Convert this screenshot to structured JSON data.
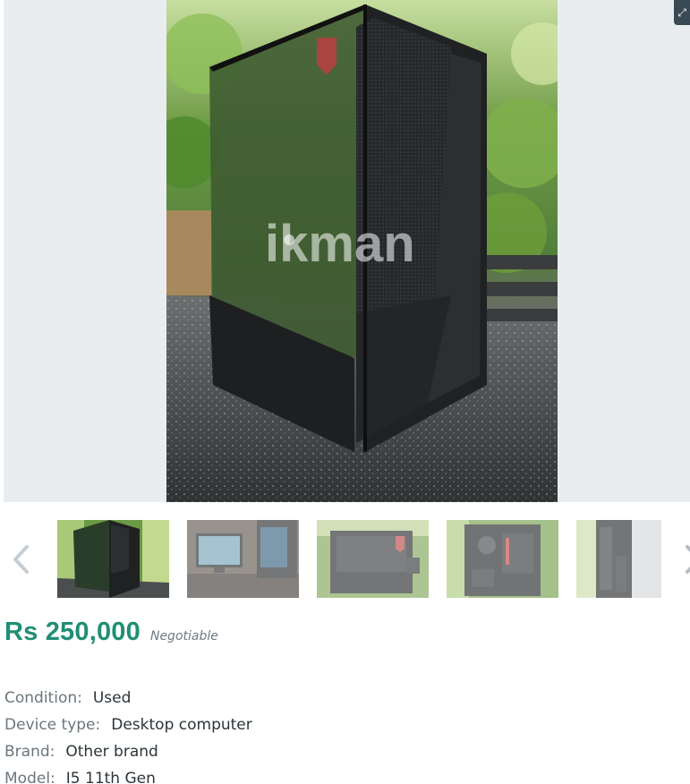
{
  "gallery": {
    "watermark": "ikman",
    "case_brand_mark": "RAIDMAX",
    "expand_icon": "expand-icon",
    "prev_icon": "chevron-left-icon",
    "next_icon": "chevron-right-icon",
    "active_thumbnail": 1,
    "thumbnail_count_visible": 5
  },
  "listing": {
    "price": "Rs 250,000",
    "price_note": "Negotiable",
    "price_color": "#1f8f74"
  },
  "attributes": [
    {
      "label": "Condition:",
      "value": "Used"
    },
    {
      "label": "Device type:",
      "value": "Desktop computer"
    },
    {
      "label": "Brand:",
      "value": "Other brand"
    },
    {
      "label": "Model:",
      "value": "I5 11th Gen"
    }
  ]
}
